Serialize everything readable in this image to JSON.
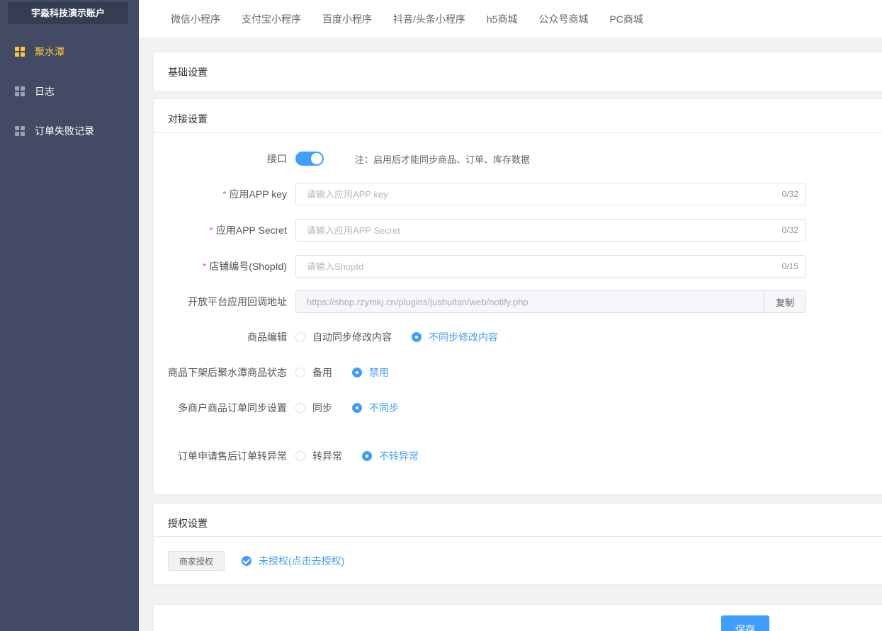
{
  "sidebar": {
    "account": "宇淼科技演示账户",
    "items": [
      {
        "label": "聚水潭",
        "active": true
      },
      {
        "label": "日志",
        "active": false
      },
      {
        "label": "订单失败记录",
        "active": false
      }
    ]
  },
  "tabs": [
    "微信小程序",
    "支付宝小程序",
    "百度小程序",
    "抖音/头条小程序",
    "h5商城",
    "公众号商城",
    "PC商城"
  ],
  "basic": {
    "title": "基础设置"
  },
  "docking": {
    "title": "对接设置",
    "interface": {
      "label": "接口",
      "enabled": true,
      "note": "注：启用后才能同步商品、订单、库存数据"
    },
    "app_key": {
      "required": "*",
      "label": "应用APP key",
      "placeholder": "请输入应用APP key",
      "count": "0/32"
    },
    "app_secret": {
      "required": "*",
      "label": "应用APP Secret",
      "placeholder": "请输入应用APP Secret",
      "count": "0/32"
    },
    "shop_id": {
      "required": "*",
      "label": "店铺编号(ShopId)",
      "placeholder": "请输入ShopId",
      "count": "0/15"
    },
    "callback": {
      "label": "开放平台应用回调地址",
      "value": "https://shop.rzymkj.cn/plugins/jushuitan/web/notify.php",
      "copy": "复制"
    },
    "goods_edit": {
      "label": "商品编辑",
      "options": [
        "自动同步修改内容",
        "不同步修改内容"
      ],
      "selected": 1
    },
    "offshelf": {
      "label": "商品下架后聚水潭商品状态",
      "options": [
        "备用",
        "禁用"
      ],
      "selected": 1
    },
    "multi_merchant": {
      "label": "多商户商品订单同步设置",
      "options": [
        "同步",
        "不同步"
      ],
      "selected": 1
    },
    "aftersale": {
      "label": "订单申请售后订单转异常",
      "options": [
        "转异常",
        "不转异常"
      ],
      "selected": 1
    }
  },
  "auth": {
    "title": "授权设置",
    "button": "商家授权",
    "status": "未授权(点击去授权)"
  },
  "save": "保存"
}
